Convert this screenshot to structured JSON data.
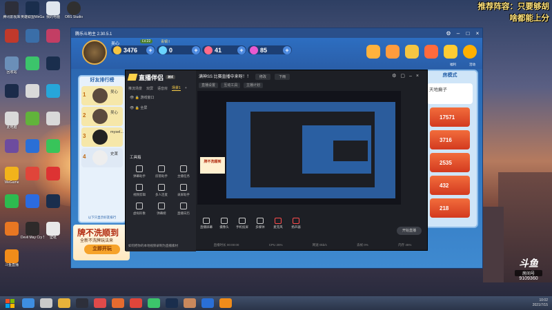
{
  "overlay": {
    "line1": "推荐阵容：只要够胡",
    "line2": "啥都能上分"
  },
  "desktop_icons": {
    "col1": [
      "腾讯影视库",
      "",
      "",
      "",
      "",
      "",
      "",
      "",
      "",
      "",
      ""
    ],
    "col2": [
      "英雄联盟WeGame",
      "",
      "",
      "",
      "",
      "",
      "",
      "",
      "",
      "",
      ""
    ],
    "col3": [
      "我的电脑",
      "",
      "",
      "",
      "",
      "",
      "",
      "",
      "",
      "",
      ""
    ],
    "col4": [
      "OBS Studio"
    ]
  },
  "icon_labels": {
    "c1": [
      "腾讯影视库",
      "",
      "回收站",
      "",
      "此电脑",
      "",
      "",
      "",
      "WeGame",
      "",
      "Kugou",
      "",
      "斗鱼直播"
    ],
    "c2": [
      "英雄联盟WeGame",
      "",
      "",
      "",
      "",
      "",
      "",
      "",
      "",
      "",
      "",
      "",
      "Devil May Cry 5"
    ],
    "c3": [
      "我的电脑",
      "",
      "",
      "",
      "",
      "",
      "",
      "",
      "",
      "",
      "",
      "",
      "壁纸"
    ]
  },
  "game": {
    "title": "腾乐斗地主 2.30.5.1",
    "player_name": "吴心",
    "level": "LV.22",
    "level_title": "青铜 I",
    "coins": "3476",
    "diamonds": "0",
    "hearts": "41",
    "tickets": "85",
    "list_header": "好友排行榜",
    "list_footer": "以下只显示好友排行",
    "rows": [
      {
        "rank": "1",
        "name": "吴心"
      },
      {
        "rank": "2",
        "name": "吴心"
      },
      {
        "rank": "3",
        "name": "mysel..."
      },
      {
        "rank": "4",
        "name": "史莱"
      }
    ],
    "promo_title": "牌不洗顺到",
    "promo_sub": "全新不洗牌玩法来",
    "promo_button": "立即开玩",
    "right_header": "房模式",
    "right_sub": "天地癞子",
    "scores": [
      "17571",
      "3716",
      "2535",
      "432",
      "218"
    ],
    "top_icons_labels": [
      "",
      "",
      "",
      "",
      "福利",
      "活动"
    ]
  },
  "obs": {
    "brand": "直播伴侣",
    "badge": "测试",
    "tabs": [
      "推流场景",
      "双屏",
      "语音房",
      "场景1"
    ],
    "sources": [
      "游戏窗口",
      "全屏"
    ],
    "title_text": "满神SS 比赛直播中来呀！！",
    "title_field": "修改",
    "category": "下雨",
    "chips": [
      "直播设置",
      "互动工具",
      "主播计划"
    ],
    "tools_header": "工具箱",
    "tools": [
      "弹幕助手",
      "房管助手",
      "主播任务",
      "视频剪辑",
      "多人连麦",
      "录屏助手",
      "虚拟形象",
      "弹幕姬",
      "直播日历"
    ],
    "tip": "如何把你的本地视频录制为直播素材",
    "bottom": [
      "直播屏幕",
      "摄像头",
      "手机投屏",
      "多媒体",
      "麦克风",
      "扬声器"
    ],
    "start_label": "开始直播",
    "status": [
      "直播时长 00:00:00",
      "CPU 25%",
      "网速 0kb/s",
      "丢帧 0%",
      "内存 45%"
    ]
  },
  "watermark": {
    "brand": "斗鱼",
    "sub": "房间号",
    "room": "9109360"
  },
  "taskbar": {
    "time": "10:02",
    "date": "2021/7/15"
  }
}
